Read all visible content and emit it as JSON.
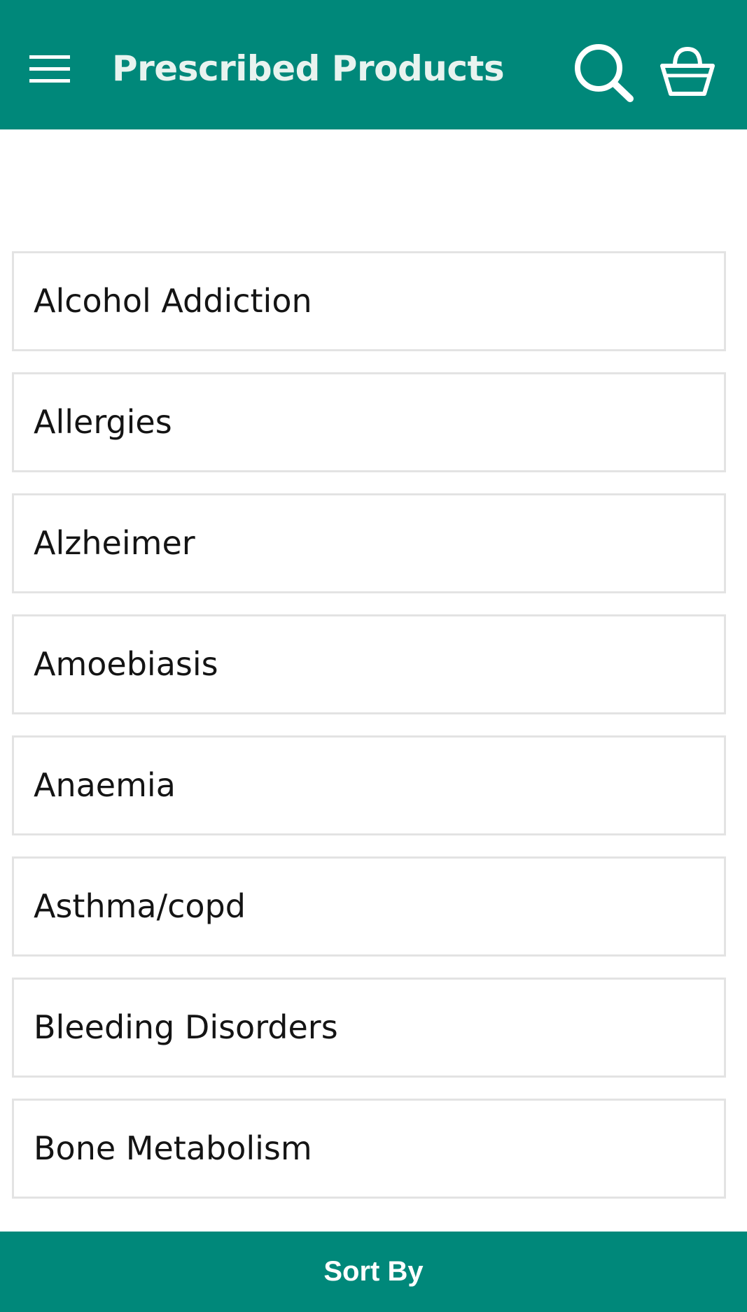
{
  "app_bar": {
    "title": "Prescribed Products",
    "menu_icon": "hamburger-menu-icon",
    "search_icon": "search-icon",
    "cart_icon": "shopping-basket-icon"
  },
  "categories": [
    {
      "label": "Alcohol Addiction"
    },
    {
      "label": "Allergies"
    },
    {
      "label": "Alzheimer"
    },
    {
      "label": "Amoebiasis"
    },
    {
      "label": "Anaemia"
    },
    {
      "label": "Asthma/copd"
    },
    {
      "label": "Bleeding Disorders"
    },
    {
      "label": "Bone Metabolism"
    }
  ],
  "sort_bar": {
    "label": "Sort By"
  },
  "colors": {
    "primary": "#00887a",
    "title_text": "#e8f3ef",
    "item_border": "#e3e3e3",
    "item_text": "#141414"
  }
}
